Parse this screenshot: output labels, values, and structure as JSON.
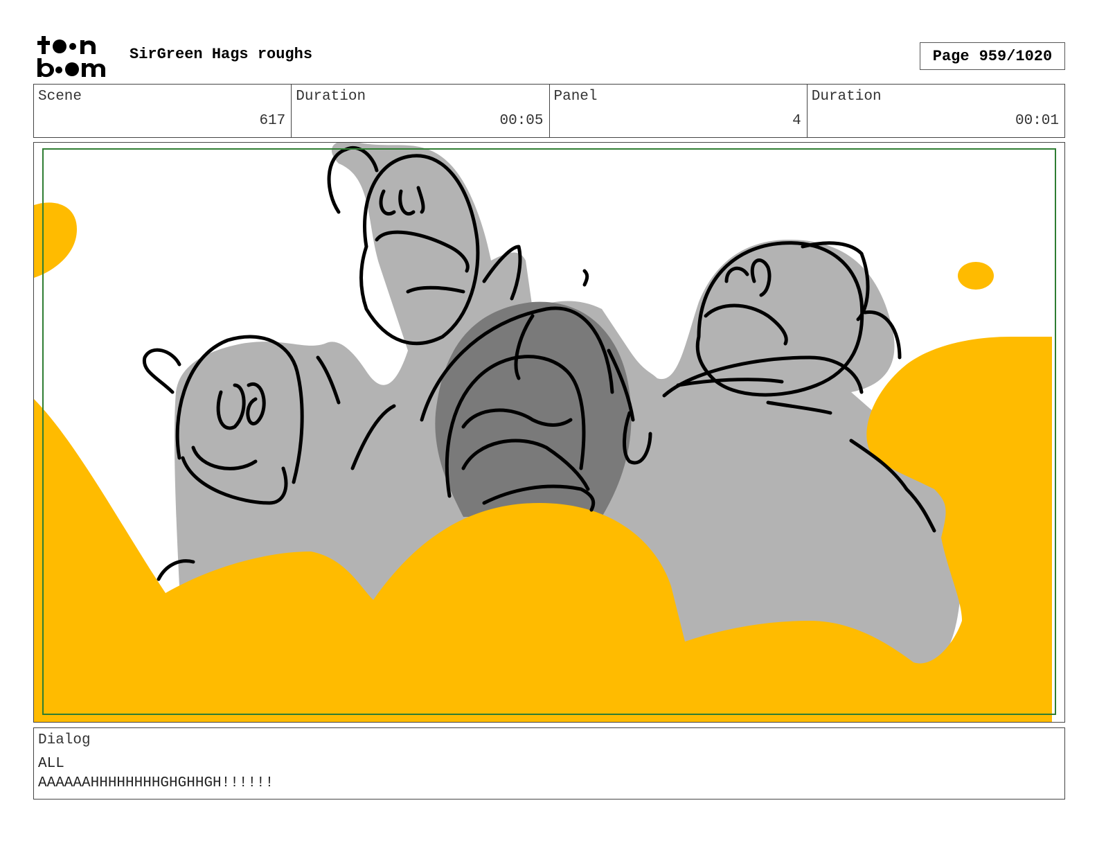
{
  "header": {
    "logo_text": "toon boom",
    "project_title": "SirGreen Hags roughs",
    "page_label": "Page",
    "page_number": "959/1020"
  },
  "info": {
    "scene_label": "Scene",
    "scene_value": "617",
    "scene_duration_label": "Duration",
    "scene_duration_value": "00:05",
    "panel_label": "Panel",
    "panel_value": "4",
    "panel_duration_label": "Duration",
    "panel_duration_value": "00:01"
  },
  "dialog": {
    "label": "Dialog",
    "lines": [
      "ALL",
      "AAAAAAHHHHHHHHGHGHHGH!!!!!!"
    ]
  },
  "colors": {
    "fill_yellow": "#FFBB00",
    "fill_gray": "#B3B3B3",
    "fill_dark_gray": "#7A7A7A",
    "safe_frame": "#2E7D32",
    "ink": "#000000"
  }
}
